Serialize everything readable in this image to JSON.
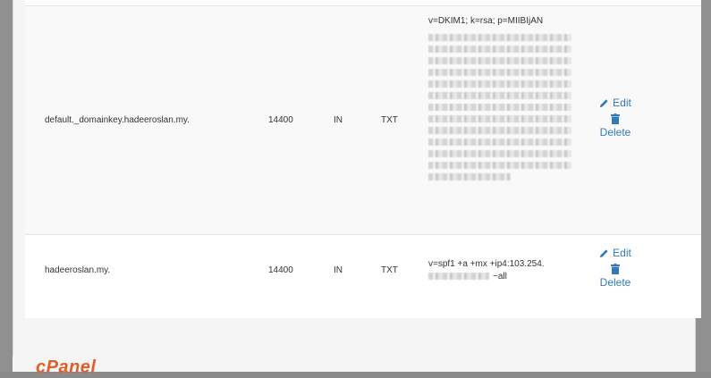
{
  "records": [
    {
      "name": "default._domainkey.hadeeroslan.my.",
      "ttl": "14400",
      "class": "IN",
      "type": "TXT",
      "record": "v=DKIM1; k=rsa; p=MIIBIjAN",
      "edit_label": "Edit",
      "delete_label": "Delete"
    },
    {
      "name": "hadeeroslan.my.",
      "ttl": "14400",
      "class": "IN",
      "type": "TXT",
      "record_line1": "v=spf1 +a +mx +ip4:103.254.",
      "record_line2_suffix": "~all",
      "edit_label": "Edit",
      "delete_label": "Delete"
    }
  ],
  "footer": {
    "logo_text": "cPanel"
  },
  "colors": {
    "link": "#337ab7",
    "brand": "#e35d2b"
  },
  "icons": {
    "edit": "pencil-icon",
    "delete": "trash-icon"
  }
}
